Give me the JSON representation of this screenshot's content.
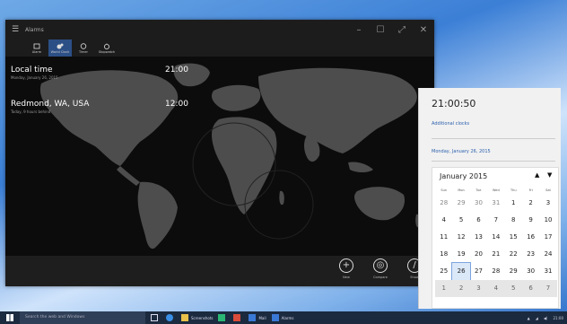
{
  "app": {
    "title": "Alarms",
    "tabs": [
      {
        "label": "Alarm",
        "icon": "alarm-clock-icon"
      },
      {
        "label": "World Clock",
        "icon": "world-clock-icon"
      },
      {
        "label": "Timer",
        "icon": "timer-icon"
      },
      {
        "label": "Stopwatch",
        "icon": "stopwatch-icon"
      }
    ],
    "clocks": [
      {
        "name": "Local time",
        "sub": "Monday, January 26, 2015",
        "time": "21:00"
      },
      {
        "name": "Redmond, WA, USA",
        "sub": "Today, 9 hours behind",
        "time": "12:00"
      }
    ],
    "commands": [
      {
        "label": "New",
        "glyph": "+"
      },
      {
        "label": "Compare",
        "glyph": "◎"
      },
      {
        "label": "Show",
        "glyph": "/"
      }
    ]
  },
  "flyout": {
    "time": "21:00:50",
    "additional_clocks": "Additional clocks",
    "date": "Monday, January 26, 2015",
    "calendar": {
      "month": "January 2015",
      "prev_glyph": "▲",
      "next_glyph": "▼",
      "weekdays": [
        "Sun",
        "Mon",
        "Tue",
        "Wed",
        "Thu",
        "Fri",
        "Sat"
      ],
      "weeks": [
        [
          "28",
          "29",
          "30",
          "31",
          "1",
          "2",
          "3"
        ],
        [
          "4",
          "5",
          "6",
          "7",
          "8",
          "9",
          "10"
        ],
        [
          "11",
          "12",
          "13",
          "14",
          "15",
          "16",
          "17"
        ],
        [
          "18",
          "19",
          "20",
          "21",
          "22",
          "23",
          "24"
        ],
        [
          "25",
          "26",
          "27",
          "28",
          "29",
          "30",
          "31"
        ],
        [
          "1",
          "2",
          "3",
          "4",
          "5",
          "6",
          "7"
        ]
      ]
    }
  },
  "taskbar": {
    "search_placeholder": "Search the web and Windows",
    "items": [
      {
        "label": "Screenshots"
      },
      {
        "label": "Mail"
      },
      {
        "label": "Alarms"
      }
    ],
    "tray_time": "21:00"
  },
  "colors": {
    "accent": "#2c4f86",
    "link": "#2a5fad"
  }
}
